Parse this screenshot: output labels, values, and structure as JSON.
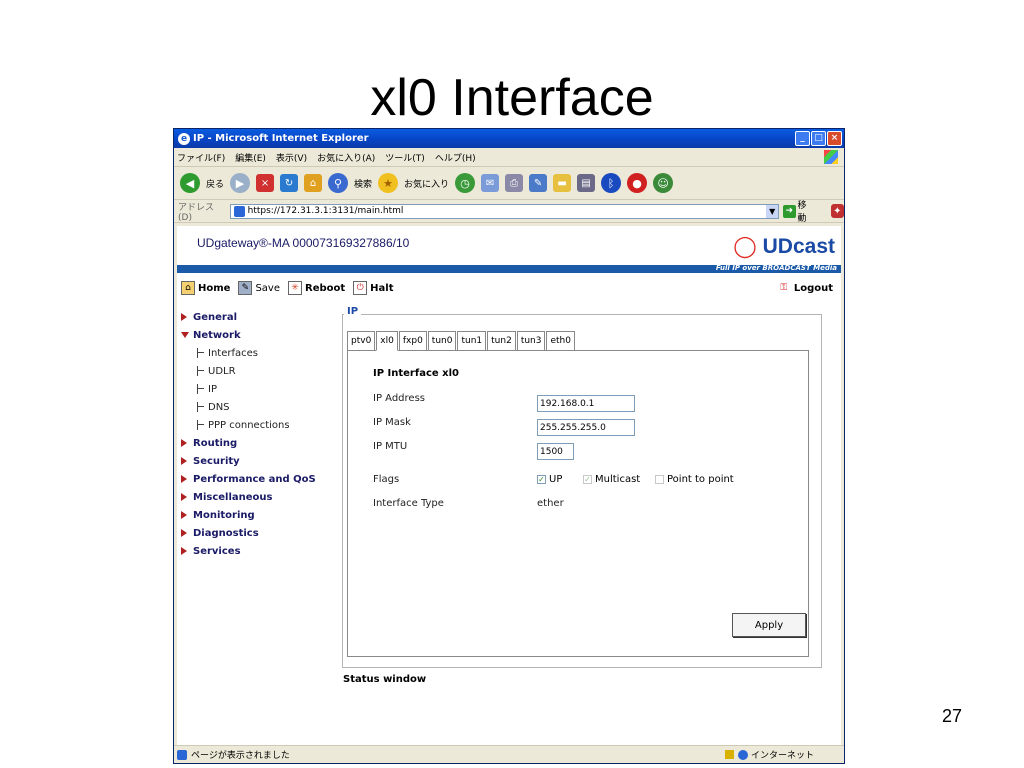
{
  "slide": {
    "title": "xl0 Interface",
    "page_number": "27"
  },
  "window": {
    "title": "IP - Microsoft Internet Explorer",
    "icon": "ie-icon"
  },
  "menubar": {
    "items": [
      "ファイル(F)",
      "編集(E)",
      "表示(V)",
      "お気に入り(A)",
      "ツール(T)",
      "ヘルプ(H)"
    ]
  },
  "toolbar": {
    "back_label": "戻る",
    "search_label": "検索",
    "favorites_label": "お気に入り"
  },
  "address": {
    "label": "アドレス(D)",
    "url": "https://172.31.3.1:3131/main.html",
    "go_label": "移動"
  },
  "app": {
    "device": "UDgateway®-MA  000073169327886/10",
    "logo": "UDcast",
    "tagline": "Full IP over BROADCAST Media",
    "actions": {
      "home": "Home",
      "save": "Save",
      "reboot": "Reboot",
      "halt": "Halt",
      "logout": "Logout"
    }
  },
  "nav": {
    "general": "General",
    "network": "Network",
    "network_sub": [
      "Interfaces",
      "UDLR",
      "IP",
      "DNS",
      "PPP connections"
    ],
    "others": [
      "Routing",
      "Security",
      "Performance and QoS",
      "Miscellaneous",
      "Monitoring",
      "Diagnostics",
      "Services"
    ]
  },
  "ip_section": {
    "legend": "IP",
    "tabs": [
      "ptv0",
      "xl0",
      "fxp0",
      "tun0",
      "tun1",
      "tun2",
      "tun3",
      "eth0"
    ],
    "active_tab": "xl0",
    "panel_title": "IP Interface xl0",
    "ip_address_label": "IP Address",
    "ip_address": "192.168.0.1",
    "ip_mask_label": "IP Mask",
    "ip_mask": "255.255.255.0",
    "ip_mtu_label": "IP MTU",
    "ip_mtu": "1500",
    "flags_label": "Flags",
    "flags": {
      "up": "UP",
      "multicast": "Multicast",
      "p2p": "Point to point"
    },
    "interface_type_label": "Interface Type",
    "interface_type": "ether",
    "apply": "Apply",
    "status_window": "Status window"
  },
  "statusbar": {
    "text": "ページが表示されました",
    "zone": "インターネット"
  }
}
